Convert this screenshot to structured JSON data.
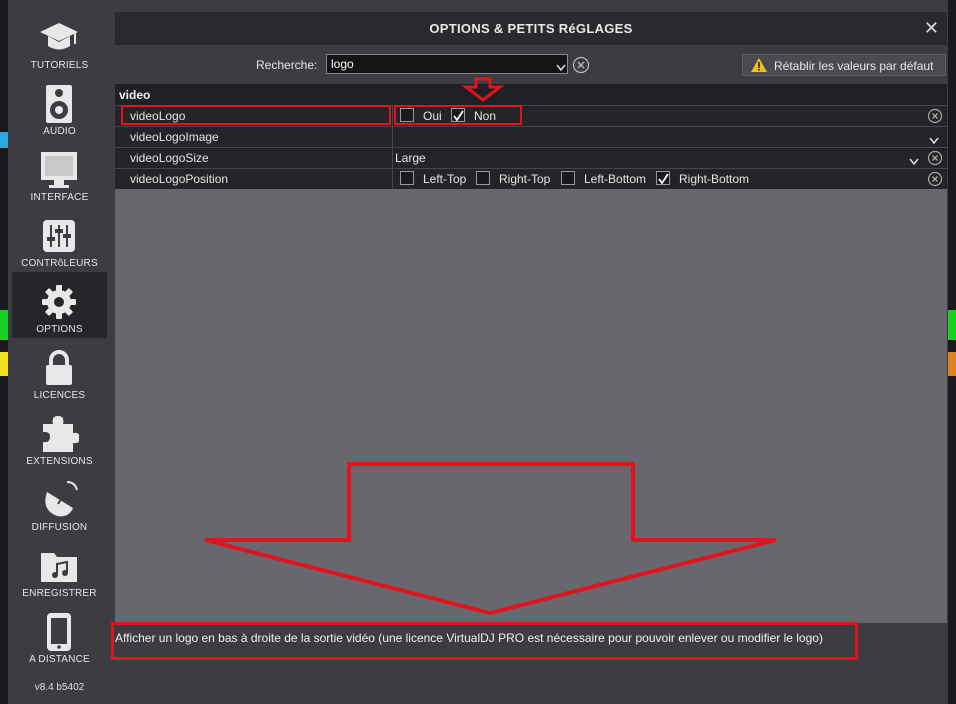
{
  "sidebar": {
    "items": [
      {
        "label": "TUTORIELS",
        "icon": "graduation-cap-icon"
      },
      {
        "label": "AUDIO",
        "icon": "speaker-icon"
      },
      {
        "label": "INTERFACE",
        "icon": "monitor-icon"
      },
      {
        "label": "CONTRôLEURS",
        "icon": "sliders-icon"
      },
      {
        "label": "OPTIONS",
        "icon": "gear-icon",
        "active": true
      },
      {
        "label": "LICENCES",
        "icon": "lock-icon"
      },
      {
        "label": "EXTENSIONS",
        "icon": "puzzle-icon"
      },
      {
        "label": "DIFFUSION",
        "icon": "satellite-dish-icon"
      },
      {
        "label": "ENREGISTRER",
        "icon": "music-folder-icon"
      },
      {
        "label": "A DISTANCE",
        "icon": "phone-icon"
      }
    ],
    "version": "v8.4 b5402"
  },
  "dialog": {
    "title": "OPTIONS & PETITS RéGLAGES",
    "close": "✕"
  },
  "search": {
    "label": "Recherche:",
    "value": "logo"
  },
  "reset_button": "Rétablir les valeurs par défaut",
  "group": "video",
  "rows": [
    {
      "name": "videoLogo",
      "options": [
        {
          "label": "Oui",
          "checked": false
        },
        {
          "label": "Non",
          "checked": true
        }
      ]
    },
    {
      "name": "videoLogoImage",
      "value": ""
    },
    {
      "name": "videoLogoSize",
      "value": "Large"
    },
    {
      "name": "videoLogoPosition",
      "options": [
        {
          "label": "Left-Top",
          "checked": false
        },
        {
          "label": "Right-Top",
          "checked": false
        },
        {
          "label": "Left-Bottom",
          "checked": false
        },
        {
          "label": "Right-Bottom",
          "checked": true
        }
      ]
    }
  ],
  "description": "Afficher un logo en bas à droite de la sortie vidéo (une licence VirtualDJ PRO est nécessaire pour pouvoir enlever ou modifier le logo)",
  "colors": {
    "annotation": "#e0141c",
    "panel": "#68676e",
    "row": "#242428",
    "warning": "#f0c020"
  }
}
